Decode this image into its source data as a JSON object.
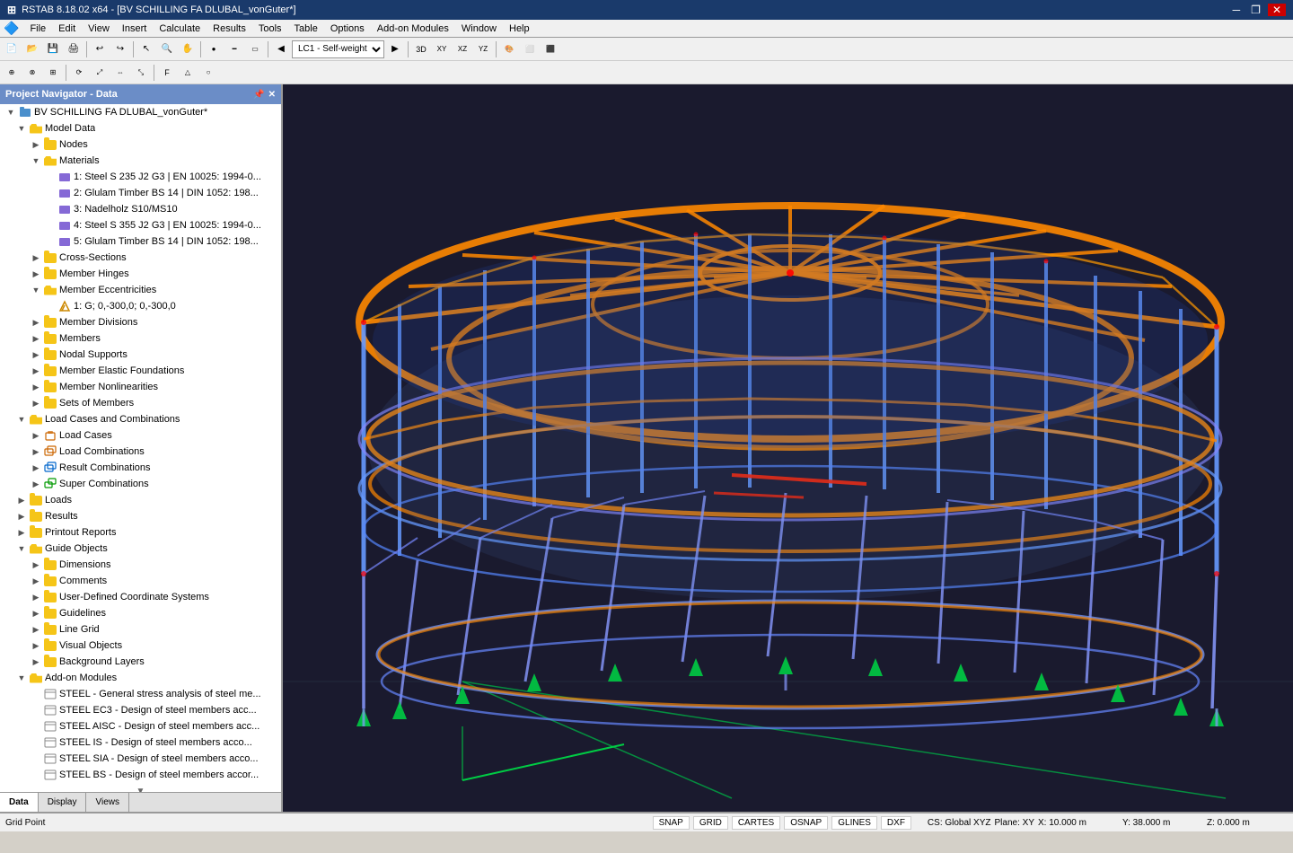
{
  "titlebar": {
    "title": "RSTAB 8.18.02 x64 - [BV SCHILLING FA DLUBAL_vonGuter*]",
    "icon": "RSTAB"
  },
  "menubar": {
    "items": [
      "File",
      "Edit",
      "View",
      "Insert",
      "Calculate",
      "Results",
      "Tools",
      "Table",
      "Options",
      "Add-on Modules",
      "Window",
      "Help"
    ]
  },
  "nav": {
    "title": "Project Navigator - Data",
    "root": "BV SCHILLING FA DLUBAL_vonGuter*",
    "tree": [
      {
        "id": "model-data",
        "label": "Model Data",
        "level": 1,
        "type": "folder-open",
        "expanded": true
      },
      {
        "id": "nodes",
        "label": "Nodes",
        "level": 2,
        "type": "folder"
      },
      {
        "id": "materials",
        "label": "Materials",
        "level": 2,
        "type": "folder-open",
        "expanded": true
      },
      {
        "id": "mat1",
        "label": "1: Steel S 235 J2 G3 | EN 10025: 1994-03...",
        "level": 3,
        "type": "mat"
      },
      {
        "id": "mat2",
        "label": "2: Glulam Timber BS 14 | DIN 1052: 198...",
        "level": 3,
        "type": "mat"
      },
      {
        "id": "mat3",
        "label": "3: Nadelholz S10/MS10",
        "level": 3,
        "type": "mat"
      },
      {
        "id": "mat4",
        "label": "4: Steel S 355 J2 G3 | EN 10025: 1994-03...",
        "level": 3,
        "type": "mat"
      },
      {
        "id": "mat5",
        "label": "5: Glulam Timber BS 14 | DIN 1052: 198...",
        "level": 3,
        "type": "mat"
      },
      {
        "id": "cross-sections",
        "label": "Cross-Sections",
        "level": 2,
        "type": "folder"
      },
      {
        "id": "member-hinges",
        "label": "Member Hinges",
        "level": 2,
        "type": "folder"
      },
      {
        "id": "member-eccentricities",
        "label": "Member Eccentricities",
        "level": 2,
        "type": "folder-open",
        "expanded": true
      },
      {
        "id": "ecc1",
        "label": "1: G; 0,-300,0; 0,-300,0",
        "level": 3,
        "type": "ecc"
      },
      {
        "id": "member-divisions",
        "label": "Member Divisions",
        "level": 2,
        "type": "folder"
      },
      {
        "id": "members",
        "label": "Members",
        "level": 2,
        "type": "folder"
      },
      {
        "id": "nodal-supports",
        "label": "Nodal Supports",
        "level": 2,
        "type": "folder"
      },
      {
        "id": "member-elastic",
        "label": "Member Elastic Foundations",
        "level": 2,
        "type": "folder"
      },
      {
        "id": "member-nonlinearities",
        "label": "Member Nonlinearities",
        "level": 2,
        "type": "folder"
      },
      {
        "id": "sets-of-members",
        "label": "Sets of Members",
        "level": 2,
        "type": "folder"
      },
      {
        "id": "load-cases-combinations",
        "label": "Load Cases and Combinations",
        "level": 1,
        "type": "folder-open",
        "expanded": true
      },
      {
        "id": "load-cases",
        "label": "Load Cases",
        "level": 2,
        "type": "folder"
      },
      {
        "id": "load-combinations",
        "label": "Load Combinations",
        "level": 2,
        "type": "folder"
      },
      {
        "id": "result-combinations",
        "label": "Result Combinations",
        "level": 2,
        "type": "folder"
      },
      {
        "id": "super-combinations",
        "label": "Super Combinations",
        "level": 2,
        "type": "folder"
      },
      {
        "id": "loads",
        "label": "Loads",
        "level": 1,
        "type": "folder"
      },
      {
        "id": "results",
        "label": "Results",
        "level": 1,
        "type": "folder"
      },
      {
        "id": "printout-reports",
        "label": "Printout Reports",
        "level": 1,
        "type": "folder"
      },
      {
        "id": "guide-objects",
        "label": "Guide Objects",
        "level": 1,
        "type": "folder-open",
        "expanded": true
      },
      {
        "id": "dimensions",
        "label": "Dimensions",
        "level": 2,
        "type": "folder"
      },
      {
        "id": "comments",
        "label": "Comments",
        "level": 2,
        "type": "folder"
      },
      {
        "id": "user-coord",
        "label": "User-Defined Coordinate Systems",
        "level": 2,
        "type": "folder"
      },
      {
        "id": "guidelines",
        "label": "Guidelines",
        "level": 2,
        "type": "folder"
      },
      {
        "id": "line-grid",
        "label": "Line Grid",
        "level": 2,
        "type": "folder"
      },
      {
        "id": "visual-objects",
        "label": "Visual Objects",
        "level": 2,
        "type": "folder"
      },
      {
        "id": "background-layers",
        "label": "Background Layers",
        "level": 2,
        "type": "folder"
      },
      {
        "id": "add-on-modules",
        "label": "Add-on Modules",
        "level": 1,
        "type": "folder-open",
        "expanded": true
      },
      {
        "id": "steel-general",
        "label": "STEEL - General stress analysis of steel me...",
        "level": 2,
        "type": "addon"
      },
      {
        "id": "steel-ec3",
        "label": "STEEL EC3 - Design of steel members acc...",
        "level": 2,
        "type": "addon"
      },
      {
        "id": "steel-aisc",
        "label": "STEEL AISC - Design of steel members acc...",
        "level": 2,
        "type": "addon"
      },
      {
        "id": "steel-is",
        "label": "STEEL IS - Design of steel members acco...",
        "level": 2,
        "type": "addon"
      },
      {
        "id": "steel-sia",
        "label": "STEEL SIA - Design of steel members acco...",
        "level": 2,
        "type": "addon"
      },
      {
        "id": "steel-bs",
        "label": "STEEL BS - Design of steel members accor...",
        "level": 2,
        "type": "addon"
      }
    ],
    "tabs": [
      "Data",
      "Display",
      "Views"
    ]
  },
  "toolbar1": {
    "load_selector": "LC1 - Self-weight"
  },
  "statusbar": {
    "left_label": "Grid Point",
    "snap": "SNAP",
    "grid": "GRID",
    "cartes": "CARTES",
    "osnap": "OSNAP",
    "glines": "GLINES",
    "dxf": "DXF",
    "cs": "CS: Global XYZ",
    "plane": "Plane: XY",
    "x": "X:  10.000 m",
    "y": "Y:  38.000 m",
    "z": "Z:  0.000 m"
  }
}
